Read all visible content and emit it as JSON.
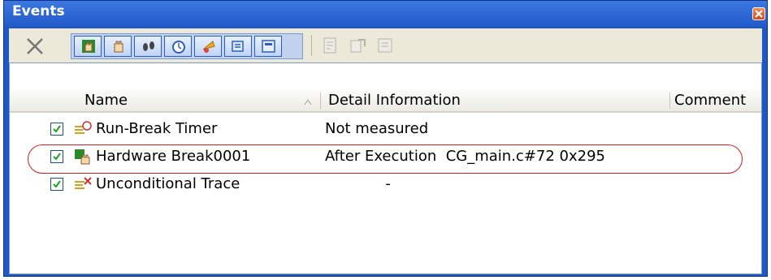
{
  "window": {
    "title": "Events",
    "close_icon": "close-icon"
  },
  "toolbar": {
    "buttons": [
      {
        "icon": "delete-icon",
        "enabled": true
      },
      {
        "icon": "hardware-break-icon",
        "enabled": true
      },
      {
        "icon": "software-break-icon",
        "enabled": true
      },
      {
        "icon": "trace-icon",
        "enabled": true
      },
      {
        "icon": "timer-icon",
        "enabled": true
      },
      {
        "icon": "action-event-icon",
        "enabled": true
      },
      {
        "icon": "other-events-icon",
        "enabled": true
      },
      {
        "icon": "edit-icon",
        "enabled": false
      },
      {
        "icon": "export-icon",
        "enabled": false
      },
      {
        "icon": "import-icon",
        "enabled": false
      }
    ]
  },
  "table": {
    "columns": [
      "Name",
      "Detail Information",
      "Comment"
    ],
    "sort_indicator": "sort-ascending-icon",
    "rows": [
      {
        "checked": true,
        "icon": "timer-event-icon",
        "name": "Run-Break Timer",
        "detail": "Not measured",
        "comment": ""
      },
      {
        "checked": true,
        "icon": "hardware-break-event-icon",
        "name": "Hardware Break0001",
        "detail": "After Execution  CG_main.c#72 0x295",
        "comment": "",
        "highlighted": true
      },
      {
        "checked": true,
        "icon": "trace-event-icon",
        "name": "Unconditional Trace",
        "detail": "             -",
        "comment": ""
      }
    ]
  },
  "colors": {
    "titlebar": "#2158c8",
    "toolbar_bg": "#ece9d8",
    "highlight_border": "#d02020",
    "checkbox_check": "#21a121"
  }
}
